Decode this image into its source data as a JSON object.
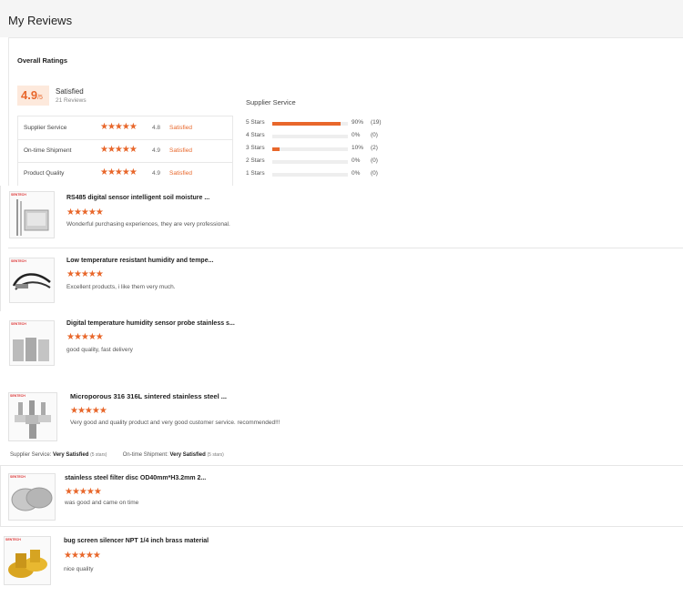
{
  "header": {
    "title": "My Reviews"
  },
  "overall": {
    "label": "Overall Ratings",
    "score": "4.9",
    "score_suffix": "/5",
    "summary": "Satisfied",
    "reviews_count": "21 Reviews",
    "metrics": [
      {
        "name": "Supplier Service",
        "stars": "★★★★★",
        "score": "4.8",
        "status": "Satisfied"
      },
      {
        "name": "On-time Shipment",
        "stars": "★★★★★",
        "score": "4.9",
        "status": "Satisfied"
      },
      {
        "name": "Product Quality",
        "stars": "★★★★★",
        "score": "4.9",
        "status": "Satisfied"
      }
    ]
  },
  "supplier_service": {
    "title": "Supplier Service",
    "distribution": [
      {
        "label": "5 Stars",
        "fraction": 0.9,
        "pct": "90%",
        "count": "(19)"
      },
      {
        "label": "4 Stars",
        "fraction": 0.0,
        "pct": "0%",
        "count": "(0)"
      },
      {
        "label": "3 Stars",
        "fraction": 0.1,
        "pct": "10%",
        "count": "(2)"
      },
      {
        "label": "2 Stars",
        "fraction": 0.0,
        "pct": "0%",
        "count": "(0)"
      },
      {
        "label": "1 Stars",
        "fraction": 0.0,
        "pct": "0%",
        "count": "(0)"
      }
    ]
  },
  "reviews": [
    {
      "title": "RS485 digital sensor intelligent soil moisture ...",
      "stars": "★★★★★",
      "text": "Wonderful purchasing experiences, they are very professional.",
      "thumb": "soil-sensor-thumbnail"
    },
    {
      "title": "Low temperature resistant humidity and tempe...",
      "stars": "★★★★★",
      "text": "Excellent products, i like them very much.",
      "thumb": "humidity-probe-cable-thumbnail"
    },
    {
      "title": "Digital temperature humidity sensor probe stainless s...",
      "stars": "★★★★★",
      "text": "good quality, fast delivery",
      "thumb": "stainless-probe-thumbnail"
    },
    {
      "title": "Microporous 316 316L sintered stainless steel ...",
      "stars": "★★★★★",
      "text": "Very good and quality product and very good  customer service. recommended!!!",
      "thumb": "sintered-filter-thumbnail"
    },
    {
      "title": "stainless steel filter disc OD40mm*H3.2mm 2...",
      "stars": "★★★★★",
      "text": "was good and came on time",
      "thumb": "filter-disc-thumbnail"
    },
    {
      "title": "bug screen silencer NPT 1/4 inch brass material",
      "stars": "★★★★★",
      "text": "nice quality",
      "thumb": "brass-silencer-thumbnail"
    }
  ],
  "review_detail": {
    "supplier_label": "Supplier Service:",
    "supplier_value": "Very Satisfied",
    "supplier_stars": "(5 stars)",
    "shipment_label": "On-time Shipment:",
    "shipment_value": "Very Satisfied",
    "shipment_stars": "(5 stars)"
  },
  "thumbnail_brand": "SENTECH",
  "colors": {
    "accent": "#e8672b",
    "score_bg": "#fde9dc",
    "band": "#f5f5f5"
  }
}
